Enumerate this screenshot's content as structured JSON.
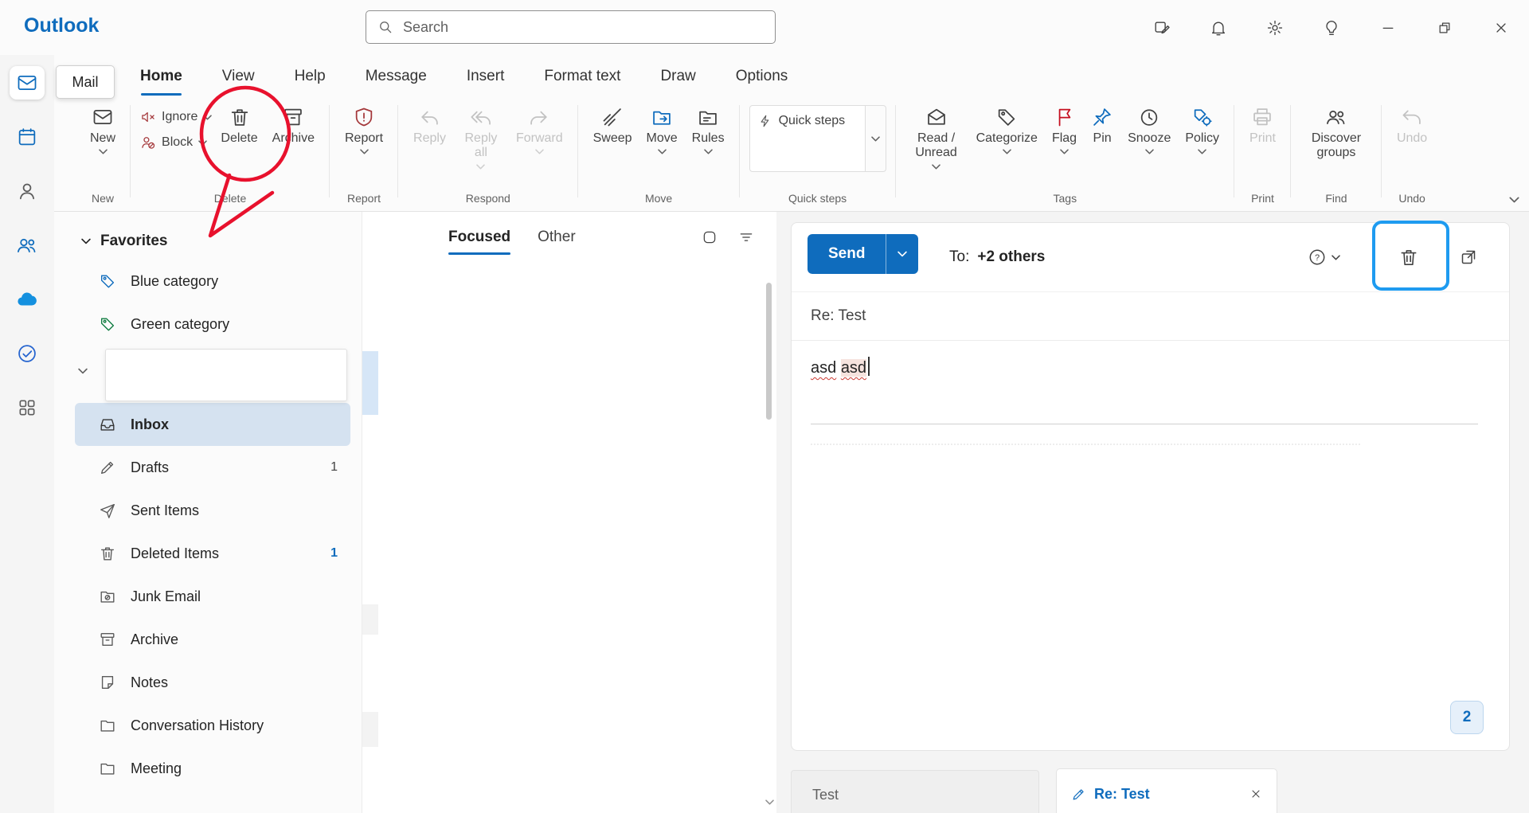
{
  "titlebar": {
    "app_name": "Outlook",
    "search_placeholder": "Search"
  },
  "nav": {
    "mail_chip": "Mail",
    "tabs": [
      {
        "label": "Home",
        "active": true
      },
      {
        "label": "View"
      },
      {
        "label": "Help"
      },
      {
        "label": "Message"
      },
      {
        "label": "Insert"
      },
      {
        "label": "Format text"
      },
      {
        "label": "Draw"
      },
      {
        "label": "Options"
      }
    ]
  },
  "ribbon": {
    "new_label": "New",
    "ignore_label": "Ignore",
    "block_label": "Block",
    "delete_label": "Delete",
    "archive_label": "Archive",
    "report_label": "Report",
    "reply_label": "Reply",
    "reply_all_label": "Reply all",
    "forward_label": "Forward",
    "sweep_label": "Sweep",
    "move_label": "Move",
    "rules_label": "Rules",
    "quick_steps_label": "Quick steps",
    "read_unread_label": "Read / Unread",
    "categorize_label": "Categorize",
    "flag_label": "Flag",
    "pin_label": "Pin",
    "snooze_label": "Snooze",
    "policy_label": "Policy",
    "print_label": "Print",
    "discover_groups_label": "Discover groups",
    "undo_label": "Undo",
    "groups": {
      "new": "New",
      "delete": "Delete",
      "report": "Report",
      "respond": "Respond",
      "move": "Move",
      "quick_steps": "Quick steps",
      "tags": "Tags",
      "print": "Print",
      "find": "Find",
      "undo": "Undo"
    }
  },
  "sidebar": {
    "favorites_header": "Favorites",
    "rename_box_value": "",
    "items": [
      {
        "icon": "tag-blue",
        "label": "Blue category"
      },
      {
        "icon": "tag-green",
        "label": "Green category"
      },
      {
        "icon": "inbox",
        "label": "Inbox",
        "selected": true
      },
      {
        "icon": "drafts",
        "label": "Drafts",
        "count": "1"
      },
      {
        "icon": "sent",
        "label": "Sent Items"
      },
      {
        "icon": "deleted",
        "label": "Deleted Items",
        "count": "1"
      },
      {
        "icon": "junk",
        "label": "Junk Email"
      },
      {
        "icon": "archive",
        "label": "Archive"
      },
      {
        "icon": "notes",
        "label": "Notes"
      },
      {
        "icon": "history",
        "label": "Conversation History"
      },
      {
        "icon": "meeting",
        "label": "Meeting"
      }
    ]
  },
  "message_list": {
    "focused_tab": "Focused",
    "other_tab": "Other"
  },
  "compose": {
    "send": "Send",
    "to_label": "To:",
    "to_value": "+2 others",
    "subject": "Re: Test",
    "body_word1": "asd",
    "body_word2": "asd",
    "page_badge": "2"
  },
  "draft_bar": {
    "tab1": "Test",
    "tab2": "Re: Test"
  },
  "colors": {
    "accent": "#0f6cbd",
    "annotation_red": "#e8112d",
    "annotation_blue": "#1e9bf0",
    "selected_folder": "#d5e2f0"
  }
}
